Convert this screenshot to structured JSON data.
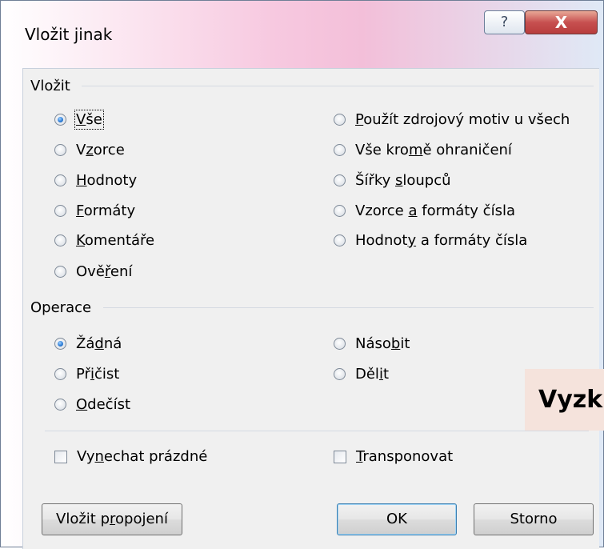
{
  "window": {
    "title": "Vložit jinak",
    "help_glyph": "?",
    "close_glyph": "X"
  },
  "paste": {
    "group_label": "Vložit",
    "left_options": [
      {
        "pre": "",
        "key": "V",
        "post": "še",
        "checked": true
      },
      {
        "pre": "V",
        "key": "z",
        "post": "orce",
        "checked": false
      },
      {
        "pre": "",
        "key": "H",
        "post": "odnoty",
        "checked": false
      },
      {
        "pre": "",
        "key": "F",
        "post": "ormáty",
        "checked": false
      },
      {
        "pre": "",
        "key": "K",
        "post": "omentáře",
        "checked": false
      },
      {
        "pre": "Ově",
        "key": "ř",
        "post": "ení",
        "checked": false
      }
    ],
    "right_options": [
      {
        "pre": "",
        "key": "P",
        "post": "oužít zdrojový motiv u všech",
        "checked": false
      },
      {
        "pre": "Vše kro",
        "key": "m",
        "post": "ě ohraničení",
        "checked": false
      },
      {
        "pre": "Šířky ",
        "key": "s",
        "post": "loupců",
        "checked": false
      },
      {
        "pre": "Vzorce ",
        "key": "a",
        "post": " formáty čísla",
        "checked": false
      },
      {
        "pre": "Hodnot",
        "key": "y",
        "post": " a formáty čísla",
        "checked": false
      }
    ]
  },
  "operation": {
    "group_label": "Operace",
    "left_options": [
      {
        "pre": "Žá",
        "key": "d",
        "post": "ná",
        "checked": true
      },
      {
        "pre": "Př",
        "key": "i",
        "post": "čist",
        "checked": false
      },
      {
        "pre": "",
        "key": "O",
        "post": "dečíst",
        "checked": false
      }
    ],
    "right_options": [
      {
        "pre": "Náso",
        "key": "b",
        "post": "it",
        "checked": false
      },
      {
        "pre": "Děl",
        "key": "i",
        "post": "t",
        "checked": false
      }
    ]
  },
  "checkboxes": {
    "skip_blanks": {
      "pre": "Vy",
      "key": "n",
      "post": "echat prázdné",
      "checked": false
    },
    "transpose": {
      "pre": "",
      "key": "T",
      "post": "ransponovat",
      "checked": false
    }
  },
  "buttons": {
    "paste_link": {
      "pre": "Vložit p",
      "key": "r",
      "post": "opojení"
    },
    "ok": "OK",
    "cancel": "Storno"
  },
  "overlay_text": "Vyzk"
}
